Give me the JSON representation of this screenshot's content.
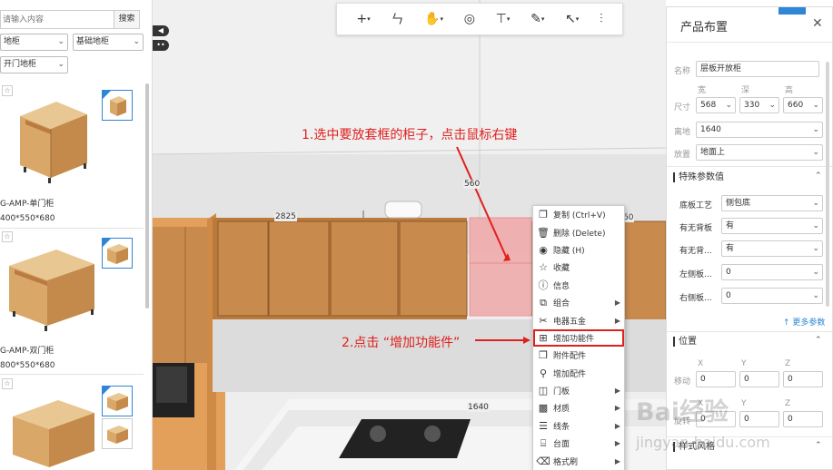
{
  "search": {
    "placeholder": "请输入内容",
    "button_label": "搜索"
  },
  "filters": {
    "category": "地柜",
    "subcategory": "基础地柜",
    "door_type": "开门地柜"
  },
  "products": [
    {
      "name": "G-AMP-单门柜",
      "dims": "400*550*680"
    },
    {
      "name": "G-AMP-双门柜",
      "dims": "800*550*680"
    }
  ],
  "toolbar": {
    "add_icon": "+",
    "measure_icon": "ㄣ",
    "hand_icon": "✋",
    "palette_icon": "◎",
    "paint_icon": "⊤",
    "ruler_icon": "✎",
    "cursor_icon": "↖",
    "sliders_icon": "⫶"
  },
  "viewport": {
    "annotation_1": "1.选中要放套框的柜子，点击鼠标右键",
    "annotation_2": "2.点击 “增加功能件”",
    "dims": {
      "d1": "2825",
      "d2": "560",
      "d3": "1640",
      "d4": "60"
    }
  },
  "context_menu": [
    {
      "label": "复制 (Ctrl+V)",
      "icon": "copy-icon",
      "glyph": "❐",
      "submenu": false
    },
    {
      "label": "删除 (Delete)",
      "icon": "trash-icon",
      "glyph": "🗑",
      "submenu": false
    },
    {
      "label": "隐藏 (H)",
      "icon": "eye-icon",
      "glyph": "◉",
      "submenu": false
    },
    {
      "label": "收藏",
      "icon": "star-icon",
      "glyph": "☆",
      "submenu": false
    },
    {
      "label": "信息",
      "icon": "info-icon",
      "glyph": "ⓘ",
      "submenu": false
    },
    {
      "label": "组合",
      "icon": "group-icon",
      "glyph": "⧉",
      "submenu": true
    },
    {
      "label": "电器五金",
      "icon": "tools-icon",
      "glyph": "✂",
      "submenu": true
    },
    {
      "label": "增加功能件",
      "icon": "add-function-icon",
      "glyph": "⊞",
      "submenu": false
    },
    {
      "label": "附件配件",
      "icon": "attachment-icon",
      "glyph": "❒",
      "submenu": false
    },
    {
      "label": "增加配件",
      "icon": "add-part-icon",
      "glyph": "⚲",
      "submenu": false
    },
    {
      "label": "门板",
      "icon": "door-icon",
      "glyph": "◫",
      "submenu": true
    },
    {
      "label": "材质",
      "icon": "material-icon",
      "glyph": "▩",
      "submenu": true
    },
    {
      "label": "线条",
      "icon": "lines-icon",
      "glyph": "☰",
      "submenu": true
    },
    {
      "label": "台面",
      "icon": "countertop-icon",
      "glyph": "⌸",
      "submenu": true
    },
    {
      "label": "格式刷",
      "icon": "brush-icon",
      "glyph": "⌫",
      "submenu": true
    }
  ],
  "properties": {
    "title": "产品布置",
    "close_icon": "✕",
    "name_label": "名称",
    "name_value": "层板开放柜",
    "size_label": "尺寸",
    "width_label": "宽",
    "depth_label": "深",
    "height_label": "高",
    "width": "568",
    "depth": "330",
    "height": "660",
    "elev_label": "离地",
    "elev_value": "1640",
    "place_label": "放置",
    "place_value": "地面上",
    "special_section": "特殊参数值",
    "params": [
      {
        "label": "底板工艺",
        "value": "侧包底"
      },
      {
        "label": "有无背板",
        "value": "有"
      },
      {
        "label": "有无背...",
        "value": "有"
      },
      {
        "label": "左侧板...",
        "value": "0"
      },
      {
        "label": "右侧板...",
        "value": "0"
      }
    ],
    "more_link": "↑ 更多参数",
    "position_section": "位置",
    "pos_x_label": "X",
    "pos_y_label": "Y",
    "pos_z_label": "Z",
    "move_label": "移动",
    "move_x": "0",
    "move_y": "0",
    "move_z": "0",
    "rotate_x_label": "X",
    "rotate_y_label": "Y",
    "rotate_z_label": "Z",
    "rotate_label": "旋转",
    "rotate_x": "0",
    "rotate_y": "0",
    "rotate_z": "0",
    "style_section": "样式风格"
  },
  "watermark": {
    "main": "Bai经验",
    "sub": "jingyan.baidu.com"
  },
  "colors": {
    "annotation": "#e0201c",
    "accent": "#2f86d6",
    "wood": "#c98a4e"
  }
}
